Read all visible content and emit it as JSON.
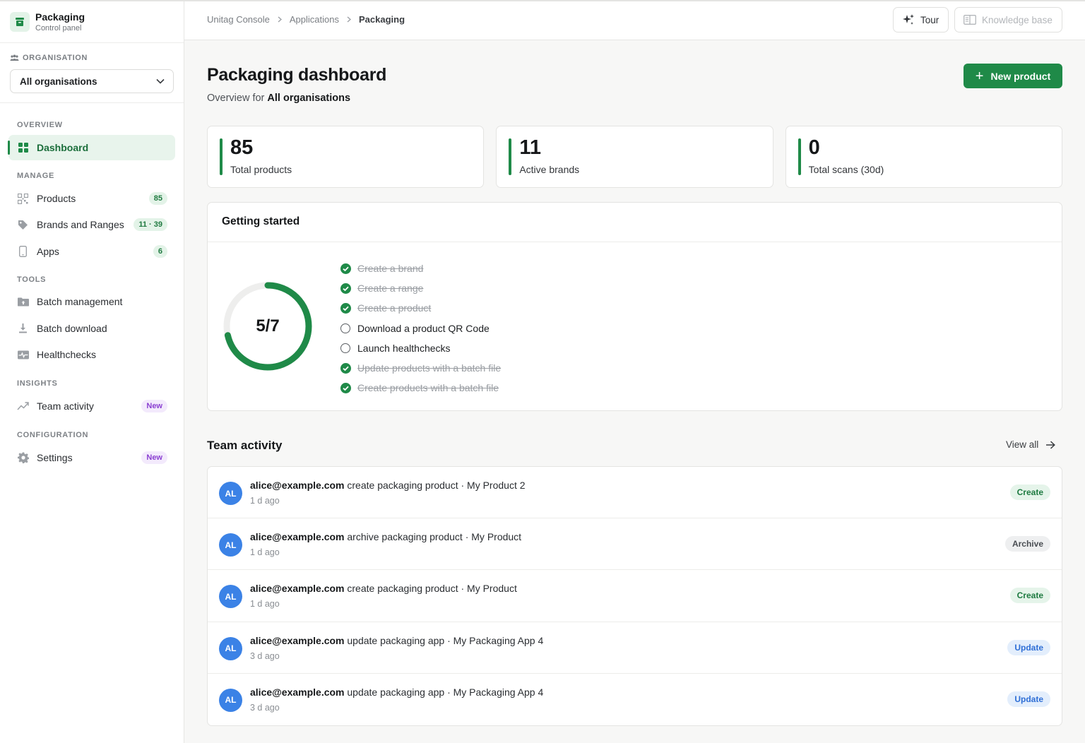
{
  "sidebar": {
    "brand_title": "Packaging",
    "brand_subtitle": "Control panel",
    "org_label": "ORGANISATION",
    "org_selected": "All organisations",
    "sections": {
      "overview": "OVERVIEW",
      "manage": "MANAGE",
      "tools": "TOOLS",
      "insights": "INSIGHTS",
      "configuration": "CONFIGURATION"
    },
    "items": {
      "dashboard": "Dashboard",
      "products": "Products",
      "products_count": "85",
      "brands": "Brands and Ranges",
      "brands_count": "11 · 39",
      "apps": "Apps",
      "apps_count": "6",
      "batch_management": "Batch management",
      "batch_download": "Batch download",
      "healthchecks": "Healthchecks",
      "team_activity": "Team activity",
      "team_activity_badge": "New",
      "settings": "Settings",
      "settings_badge": "New"
    }
  },
  "header": {
    "breadcrumbs": [
      "Unitag Console",
      "Applications",
      "Packaging"
    ],
    "tour_label": "Tour",
    "kb_label": "Knowledge base"
  },
  "main": {
    "title": "Packaging dashboard",
    "subtitle_prefix": "Overview for",
    "subtitle_org": "All organisations",
    "new_product_label": "New product",
    "stats": [
      {
        "value": "85",
        "label": "Total products"
      },
      {
        "value": "11",
        "label": "Active brands"
      },
      {
        "value": "0",
        "label": "Total scans (30d)"
      }
    ],
    "getting_started": {
      "title": "Getting started",
      "progress_text": "5/7",
      "progress_fraction": 0.714,
      "steps": [
        {
          "label": "Create a brand",
          "done": true
        },
        {
          "label": "Create a range",
          "done": true
        },
        {
          "label": "Create a product",
          "done": true
        },
        {
          "label": "Download a product QR Code",
          "done": false
        },
        {
          "label": "Launch healthchecks",
          "done": false
        },
        {
          "label": "Update products with a batch file",
          "done": true
        },
        {
          "label": "Create products with a batch file",
          "done": true
        }
      ]
    },
    "team_activity": {
      "title": "Team activity",
      "view_all": "View all",
      "rows": [
        {
          "initials": "AL",
          "actor": "alice@example.com",
          "action": "create packaging product · My Product 2",
          "time": "1 d ago",
          "tag": "Create"
        },
        {
          "initials": "AL",
          "actor": "alice@example.com",
          "action": "archive packaging product · My Product",
          "time": "1 d ago",
          "tag": "Archive"
        },
        {
          "initials": "AL",
          "actor": "alice@example.com",
          "action": "create packaging product · My Product",
          "time": "1 d ago",
          "tag": "Create"
        },
        {
          "initials": "AL",
          "actor": "alice@example.com",
          "action": "update packaging app · My Packaging App 4",
          "time": "3 d ago",
          "tag": "Update"
        },
        {
          "initials": "AL",
          "actor": "alice@example.com",
          "action": "update packaging app · My Packaging App 4",
          "time": "3 d ago",
          "tag": "Update"
        }
      ]
    }
  },
  "colors": {
    "accent": "#1f8a48",
    "accent_light": "#e3f3e8",
    "avatar": "#3b82e6",
    "new_badge": "#8a3fd1"
  }
}
